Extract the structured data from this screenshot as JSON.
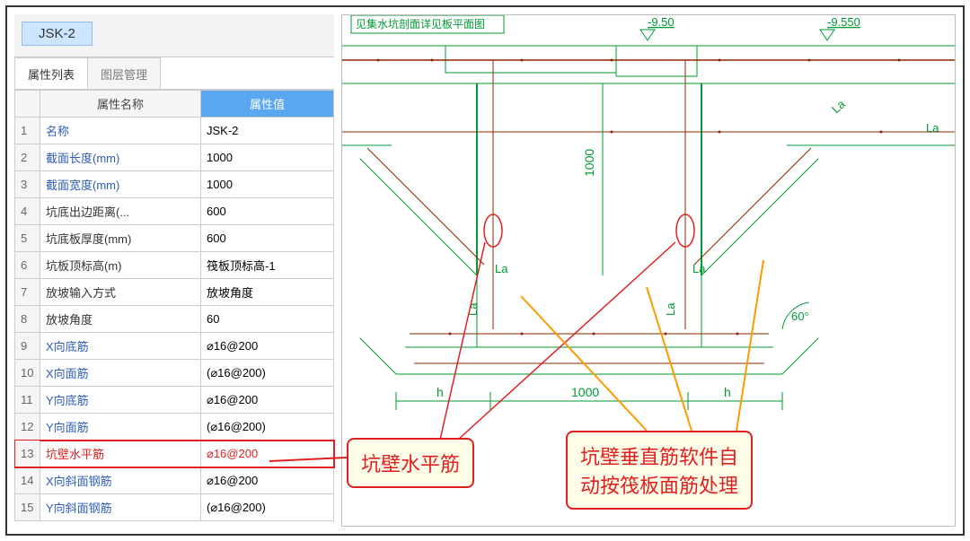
{
  "header": {
    "component_name": "JSK-2"
  },
  "tabs": [
    {
      "label": "属性列表",
      "active": true
    },
    {
      "label": "图层管理",
      "active": false
    }
  ],
  "columns": {
    "name": "属性名称",
    "value": "属性值"
  },
  "rows": [
    {
      "n": "1",
      "name": "名称",
      "val": "JSK-2",
      "plain": false
    },
    {
      "n": "2",
      "name": "截面长度(mm)",
      "val": "1000",
      "plain": false
    },
    {
      "n": "3",
      "name": "截面宽度(mm)",
      "val": "1000",
      "plain": false
    },
    {
      "n": "4",
      "name": "坑底出边距离(...",
      "val": "600",
      "plain": true
    },
    {
      "n": "5",
      "name": "坑底板厚度(mm)",
      "val": "600",
      "plain": true
    },
    {
      "n": "6",
      "name": "坑板顶标高(m)",
      "val": "筏板顶标高-1",
      "plain": true
    },
    {
      "n": "7",
      "name": "放坡输入方式",
      "val": "放坡角度",
      "plain": true
    },
    {
      "n": "8",
      "name": "放坡角度",
      "val": "60",
      "plain": true
    },
    {
      "n": "9",
      "name": "X向底筋",
      "val": "⌀16@200",
      "plain": false
    },
    {
      "n": "10",
      "name": "X向面筋",
      "val": "(⌀16@200)",
      "plain": false
    },
    {
      "n": "11",
      "name": "Y向底筋",
      "val": "⌀16@200",
      "plain": false
    },
    {
      "n": "12",
      "name": "Y向面筋",
      "val": "(⌀16@200)",
      "plain": false
    },
    {
      "n": "13",
      "name": "坑壁水平筋",
      "val": "⌀16@200",
      "plain": false,
      "hl": true
    },
    {
      "n": "14",
      "name": "X向斜面钢筋",
      "val": "⌀16@200",
      "plain": false
    },
    {
      "n": "15",
      "name": "Y向斜面钢筋",
      "val": "(⌀16@200)",
      "plain": false
    }
  ],
  "callouts": {
    "left": "坑壁水平筋",
    "right": "坑壁垂直筋软件自\n动按筏板面筋处理"
  },
  "drawing": {
    "title": "见集水坑剖面详见板平面图",
    "elev_left": "-9.50",
    "elev_right": "-9.550",
    "La": "La",
    "dim1000_v": "1000",
    "dim1000_h": "1000",
    "h": "h",
    "angle": "60°"
  }
}
